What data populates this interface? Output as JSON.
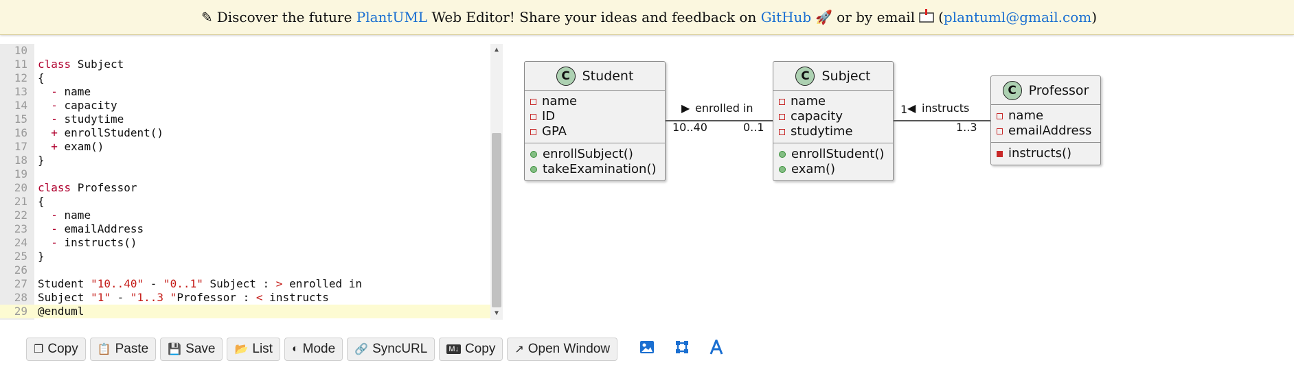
{
  "banner": {
    "prefix": "Discover the future",
    "plantuml_link": "PlantUML",
    "middle": "Web Editor! Share your ideas and feedback on",
    "github_link": "GitHub",
    "or_email": "or by email",
    "email_open": "(",
    "email_link": "plantuml@gmail.com",
    "email_close": ")",
    "icons": [
      "pencil-icon",
      "rocket-icon",
      "mailbox-icon"
    ]
  },
  "editor": {
    "lines": [
      {
        "n": "10"
      },
      {
        "n": "11"
      },
      {
        "n": "12"
      },
      {
        "n": "13"
      },
      {
        "n": "14"
      },
      {
        "n": "15"
      },
      {
        "n": "16"
      },
      {
        "n": "17"
      },
      {
        "n": "18"
      },
      {
        "n": "19"
      },
      {
        "n": "20"
      },
      {
        "n": "21"
      },
      {
        "n": "22"
      },
      {
        "n": "23"
      },
      {
        "n": "24"
      },
      {
        "n": "25"
      },
      {
        "n": "26"
      },
      {
        "n": "27"
      },
      {
        "n": "28"
      },
      {
        "n": "29"
      }
    ],
    "code": {
      "l11_kw": "class",
      "l11_rest": " Subject",
      "l12": "{",
      "l13_mod": "  -",
      "l13_rest": " name",
      "l14_mod": "  -",
      "l14_rest": " capacity",
      "l15_mod": "  -",
      "l15_rest": " studytime",
      "l16_mod": "  +",
      "l16_rest": " enrollStudent()",
      "l17_mod": "  +",
      "l17_rest": " exam()",
      "l18": "}",
      "l20_kw": "class",
      "l20_rest": " Professor",
      "l21": "{",
      "l22_mod": "  -",
      "l22_rest": " name",
      "l23_mod": "  -",
      "l23_rest": " emailAddress",
      "l24_mod": "  -",
      "l24_rest": " instructs()",
      "l25": "}",
      "l27_a": "Student ",
      "l27_s1": "\"10..40\"",
      "l27_b": " - ",
      "l27_s2": "\"0..1\"",
      "l27_c": " Subject : ",
      "l27_arrow": ">",
      "l27_d": " enrolled in",
      "l28_a": "Subject ",
      "l28_s1": "\"1\"",
      "l28_b": " - ",
      "l28_s2": "\"1..3 \"",
      "l28_c": "Professor : ",
      "l28_arrow": "<",
      "l28_d": " instructs",
      "l29": "@enduml"
    }
  },
  "diagram": {
    "badge": "C",
    "student": {
      "name": "Student",
      "attributes": [
        "name",
        "ID",
        "GPA"
      ],
      "methods": [
        "enrollSubject()",
        "takeExamination()"
      ]
    },
    "subject": {
      "name": "Subject",
      "attributes": [
        "name",
        "capacity",
        "studytime"
      ],
      "methods": [
        "enrollStudent()",
        "exam()"
      ]
    },
    "professor": {
      "name": "Professor",
      "attributes": [
        "name",
        "emailAddress"
      ],
      "methods": [
        "instructs()"
      ]
    },
    "assoc1": {
      "label": "enrolled in",
      "arrow": "▶",
      "left_mult": "10..40",
      "right_mult": "0..1"
    },
    "assoc2": {
      "label": "instructs",
      "arrow": "◀",
      "left_mult": "1",
      "right_mult": "1..3"
    },
    "colors": {
      "private": "#c82929",
      "public": "#84be84",
      "badge": "#add1b2"
    }
  },
  "toolbar": {
    "buttons": [
      {
        "label": "Copy",
        "icon": "copy-icon"
      },
      {
        "label": "Paste",
        "icon": "paste-icon"
      },
      {
        "label": "Save",
        "icon": "save-icon"
      },
      {
        "label": "List",
        "icon": "folder-icon"
      },
      {
        "label": "Mode",
        "icon": "contrast-icon"
      },
      {
        "label": "SyncURL",
        "icon": "link-icon"
      },
      {
        "label": "Copy",
        "icon": "markdown-icon"
      },
      {
        "label": "Open Window",
        "icon": "external-link-icon"
      }
    ],
    "icons": [
      "image-icon",
      "crop-icon",
      "text-icon"
    ]
  }
}
